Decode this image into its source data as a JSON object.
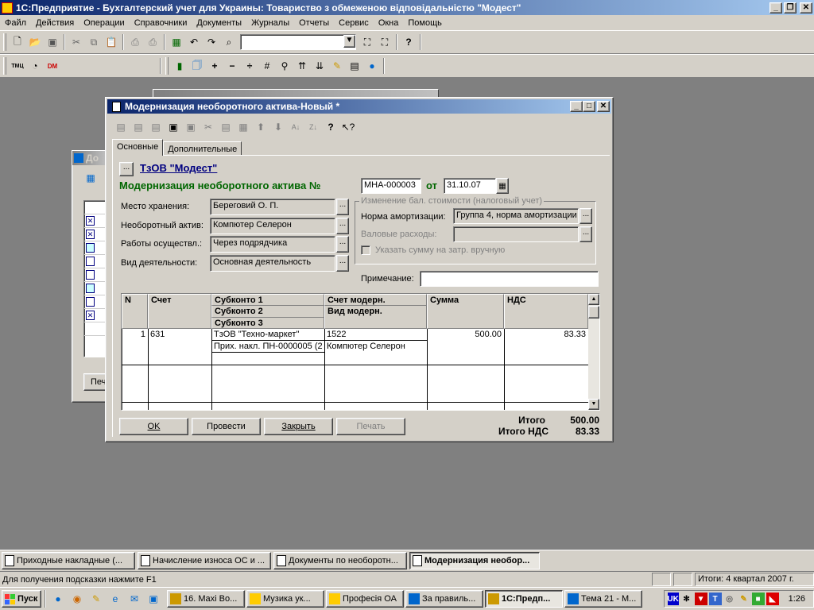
{
  "app": {
    "title": "1С:Предприятие - Бухгалтерский учет для Украины: Товариство  з  обмеженою  відповідальністю  \"Модест\""
  },
  "menu": [
    "Файл",
    "Действия",
    "Операции",
    "Справочники",
    "Документы",
    "Журналы",
    "Отчеты",
    "Сервис",
    "Окна",
    "Помощь"
  ],
  "toolbar1": {
    "icons": [
      "new-icon",
      "open-icon",
      "save-icon",
      "cut-icon",
      "copy-icon",
      "paste-icon",
      "print-icon",
      "print-preview-icon",
      "calculator-icon",
      "undo-icon",
      "redo-icon",
      "find-icon",
      "search-next-icon",
      "search-prev-icon",
      "help-icon"
    ],
    "search_value": ""
  },
  "toolbar2": {
    "tmc_label": "ТМЦ",
    "dm_label": "DM"
  },
  "bg_window": {
    "title_partial": "До",
    "print_btn_partial": "Печ"
  },
  "dialog": {
    "title": "Модернизация необоротного актива-Новый *",
    "tabs": [
      "Основные",
      "Дополнительные"
    ],
    "org_link": "ТзОВ \"Модест\"",
    "doc_heading": "Модернизация необоротного актива №",
    "doc_number": "МНА-000003",
    "date_label": "от",
    "date_value": "31.10.07",
    "fields": {
      "storage_label": "Место хранения:",
      "storage_value": "Береговий О. П.",
      "asset_label": "Необоротный актив:",
      "asset_value": "Компютер Селерон",
      "works_label": "Работы осуществл.:",
      "works_value": "Через подрядчика",
      "activity_label": "Вид деятельности:",
      "activity_value": "Основная деятельность"
    },
    "tax_group": {
      "legend": "Изменение бал. стоимости (налоговый учет)",
      "norm_label": "Норма амортизации:",
      "norm_value": "Группа 4, норма амортизации",
      "gross_label": "Валовые расходы:",
      "gross_value": "",
      "checkbox_label": "Указать сумму на затр. вручную"
    },
    "note_label": "Примечание:",
    "note_value": "",
    "table": {
      "headers": {
        "n": "N",
        "account": "Счет",
        "sub1": "Субконто 1",
        "sub2": "Субконто 2",
        "sub3": "Субконто 3",
        "mod_account": "Счет модерн.",
        "mod_type": "Вид модерн.",
        "sum": "Сумма",
        "vat": "НДС"
      },
      "rows": [
        {
          "n": "1",
          "account": "631",
          "sub1": "ТзОВ \"Техно-маркет\"",
          "sub2": "Прих. накл. ПН-0000005 (2",
          "mod_account": "1522",
          "mod_type": "Компютер Селерон",
          "sum": "500.00",
          "vat": "83.33"
        }
      ]
    },
    "buttons": {
      "ok": "OK",
      "post": "Провести",
      "close": "Закрыть",
      "print": "Печать"
    },
    "totals": {
      "total_label": "Итого",
      "total_value": "500.00",
      "vat_label": "Итого НДС",
      "vat_value": "83.33"
    }
  },
  "mdi_tabs": [
    {
      "label": "Приходные накладные (...",
      "active": false
    },
    {
      "label": "Начисление износа ОС и ...",
      "active": false
    },
    {
      "label": "Документы по необоротн...",
      "active": false
    },
    {
      "label": "Модернизация необор...",
      "active": true
    }
  ],
  "status": {
    "hint": "Для получения подсказки нажмите F1",
    "totals": "Итоги: 4 квартал 2007 г."
  },
  "taskbar": {
    "start_label": "Пуск",
    "items": [
      {
        "label": "16. Maxi Bo...",
        "active": false
      },
      {
        "label": "Музика ук...",
        "active": false
      },
      {
        "label": "Професія ОА",
        "active": false
      },
      {
        "label": "За правиль...",
        "active": false
      },
      {
        "label": "1С:Предп...",
        "active": true
      },
      {
        "label": "Тема 21 - М...",
        "active": false
      }
    ],
    "lang": "UK",
    "clock": "1:26"
  }
}
